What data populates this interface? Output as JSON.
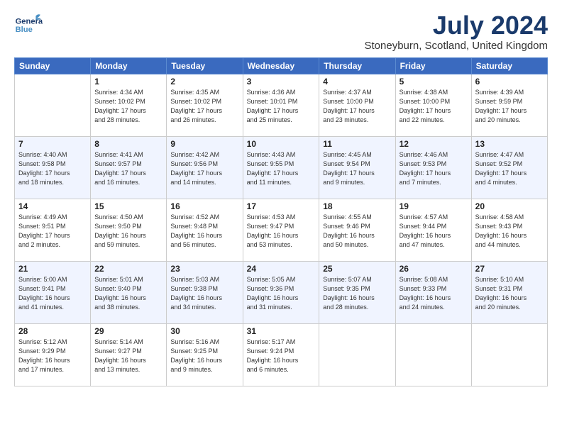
{
  "header": {
    "logo_line1": "General",
    "logo_line2": "Blue",
    "month": "July 2024",
    "location": "Stoneyburn, Scotland, United Kingdom"
  },
  "weekdays": [
    "Sunday",
    "Monday",
    "Tuesday",
    "Wednesday",
    "Thursday",
    "Friday",
    "Saturday"
  ],
  "weeks": [
    [
      {
        "day": "",
        "info": ""
      },
      {
        "day": "1",
        "info": "Sunrise: 4:34 AM\nSunset: 10:02 PM\nDaylight: 17 hours\nand 28 minutes."
      },
      {
        "day": "2",
        "info": "Sunrise: 4:35 AM\nSunset: 10:02 PM\nDaylight: 17 hours\nand 26 minutes."
      },
      {
        "day": "3",
        "info": "Sunrise: 4:36 AM\nSunset: 10:01 PM\nDaylight: 17 hours\nand 25 minutes."
      },
      {
        "day": "4",
        "info": "Sunrise: 4:37 AM\nSunset: 10:00 PM\nDaylight: 17 hours\nand 23 minutes."
      },
      {
        "day": "5",
        "info": "Sunrise: 4:38 AM\nSunset: 10:00 PM\nDaylight: 17 hours\nand 22 minutes."
      },
      {
        "day": "6",
        "info": "Sunrise: 4:39 AM\nSunset: 9:59 PM\nDaylight: 17 hours\nand 20 minutes."
      }
    ],
    [
      {
        "day": "7",
        "info": "Sunrise: 4:40 AM\nSunset: 9:58 PM\nDaylight: 17 hours\nand 18 minutes."
      },
      {
        "day": "8",
        "info": "Sunrise: 4:41 AM\nSunset: 9:57 PM\nDaylight: 17 hours\nand 16 minutes."
      },
      {
        "day": "9",
        "info": "Sunrise: 4:42 AM\nSunset: 9:56 PM\nDaylight: 17 hours\nand 14 minutes."
      },
      {
        "day": "10",
        "info": "Sunrise: 4:43 AM\nSunset: 9:55 PM\nDaylight: 17 hours\nand 11 minutes."
      },
      {
        "day": "11",
        "info": "Sunrise: 4:45 AM\nSunset: 9:54 PM\nDaylight: 17 hours\nand 9 minutes."
      },
      {
        "day": "12",
        "info": "Sunrise: 4:46 AM\nSunset: 9:53 PM\nDaylight: 17 hours\nand 7 minutes."
      },
      {
        "day": "13",
        "info": "Sunrise: 4:47 AM\nSunset: 9:52 PM\nDaylight: 17 hours\nand 4 minutes."
      }
    ],
    [
      {
        "day": "14",
        "info": "Sunrise: 4:49 AM\nSunset: 9:51 PM\nDaylight: 17 hours\nand 2 minutes."
      },
      {
        "day": "15",
        "info": "Sunrise: 4:50 AM\nSunset: 9:50 PM\nDaylight: 16 hours\nand 59 minutes."
      },
      {
        "day": "16",
        "info": "Sunrise: 4:52 AM\nSunset: 9:48 PM\nDaylight: 16 hours\nand 56 minutes."
      },
      {
        "day": "17",
        "info": "Sunrise: 4:53 AM\nSunset: 9:47 PM\nDaylight: 16 hours\nand 53 minutes."
      },
      {
        "day": "18",
        "info": "Sunrise: 4:55 AM\nSunset: 9:46 PM\nDaylight: 16 hours\nand 50 minutes."
      },
      {
        "day": "19",
        "info": "Sunrise: 4:57 AM\nSunset: 9:44 PM\nDaylight: 16 hours\nand 47 minutes."
      },
      {
        "day": "20",
        "info": "Sunrise: 4:58 AM\nSunset: 9:43 PM\nDaylight: 16 hours\nand 44 minutes."
      }
    ],
    [
      {
        "day": "21",
        "info": "Sunrise: 5:00 AM\nSunset: 9:41 PM\nDaylight: 16 hours\nand 41 minutes."
      },
      {
        "day": "22",
        "info": "Sunrise: 5:01 AM\nSunset: 9:40 PM\nDaylight: 16 hours\nand 38 minutes."
      },
      {
        "day": "23",
        "info": "Sunrise: 5:03 AM\nSunset: 9:38 PM\nDaylight: 16 hours\nand 34 minutes."
      },
      {
        "day": "24",
        "info": "Sunrise: 5:05 AM\nSunset: 9:36 PM\nDaylight: 16 hours\nand 31 minutes."
      },
      {
        "day": "25",
        "info": "Sunrise: 5:07 AM\nSunset: 9:35 PM\nDaylight: 16 hours\nand 28 minutes."
      },
      {
        "day": "26",
        "info": "Sunrise: 5:08 AM\nSunset: 9:33 PM\nDaylight: 16 hours\nand 24 minutes."
      },
      {
        "day": "27",
        "info": "Sunrise: 5:10 AM\nSunset: 9:31 PM\nDaylight: 16 hours\nand 20 minutes."
      }
    ],
    [
      {
        "day": "28",
        "info": "Sunrise: 5:12 AM\nSunset: 9:29 PM\nDaylight: 16 hours\nand 17 minutes."
      },
      {
        "day": "29",
        "info": "Sunrise: 5:14 AM\nSunset: 9:27 PM\nDaylight: 16 hours\nand 13 minutes."
      },
      {
        "day": "30",
        "info": "Sunrise: 5:16 AM\nSunset: 9:25 PM\nDaylight: 16 hours\nand 9 minutes."
      },
      {
        "day": "31",
        "info": "Sunrise: 5:17 AM\nSunset: 9:24 PM\nDaylight: 16 hours\nand 6 minutes."
      },
      {
        "day": "",
        "info": ""
      },
      {
        "day": "",
        "info": ""
      },
      {
        "day": "",
        "info": ""
      }
    ]
  ]
}
